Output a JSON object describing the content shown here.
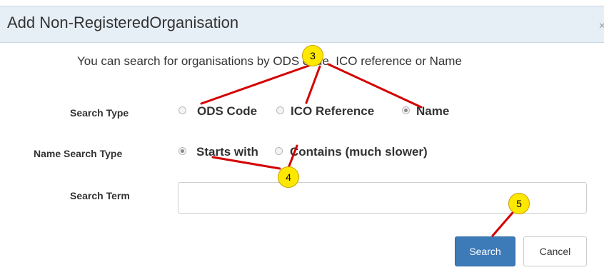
{
  "dialog": {
    "title": "Add Non-RegisteredOrganisation",
    "close": "×",
    "intro": "You can search for organisations by ODS code, ICO reference or Name"
  },
  "search_type": {
    "label": "Search Type",
    "options": [
      {
        "label": "ODS Code",
        "checked": false
      },
      {
        "label": "ICO Reference",
        "checked": false
      },
      {
        "label": "Name",
        "checked": true
      }
    ]
  },
  "name_search_type": {
    "label": "Name Search Type",
    "options": [
      {
        "label": "Starts with",
        "checked": true
      },
      {
        "label": "Contains (much slower)",
        "checked": false
      }
    ]
  },
  "search_term": {
    "label": "Search Term",
    "value": "",
    "placeholder": ""
  },
  "buttons": {
    "search": "Search",
    "cancel": "Cancel"
  },
  "callouts": [
    "3",
    "4",
    "5"
  ],
  "colors": {
    "title_bar": "#e6eef6",
    "primary_button": "#3d7ab8",
    "callout_fill": "#ffe800",
    "callout_line": "#d40000"
  }
}
